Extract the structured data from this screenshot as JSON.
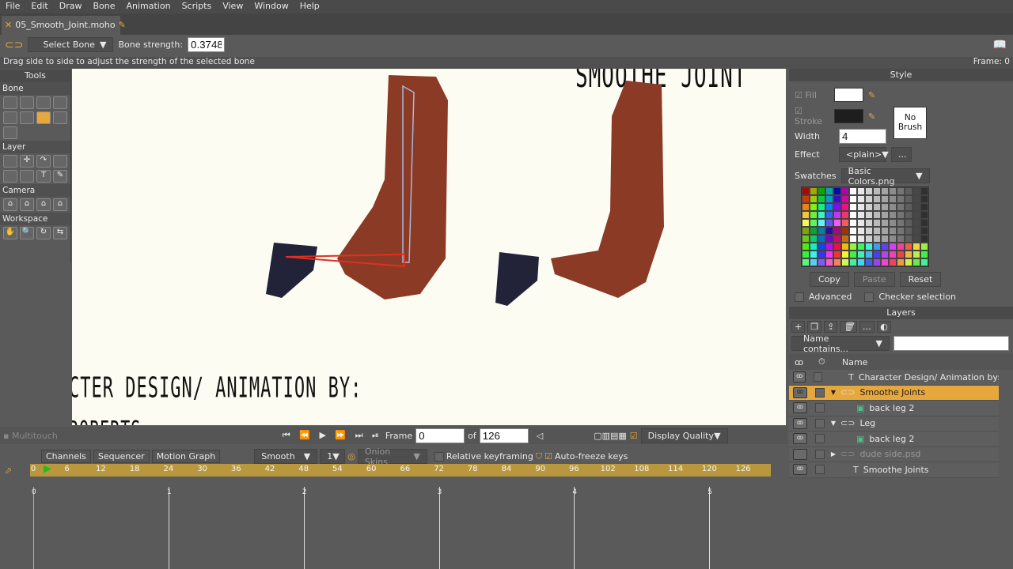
{
  "menu": [
    "File",
    "Edit",
    "Draw",
    "Bone",
    "Animation",
    "Scripts",
    "View",
    "Window",
    "Help"
  ],
  "document_tab": "05_Smooth_Joint.moho",
  "toolbar": {
    "tool": "Select Bone",
    "strength_label": "Bone strength:",
    "strength_value": "0.3748"
  },
  "status": {
    "hint": "Drag side to side to adjust the strength of the selected bone",
    "frame": "Frame: 0"
  },
  "tools": {
    "title": "Tools",
    "sections": [
      "Bone",
      "Layer",
      "Camera",
      "Workspace"
    ]
  },
  "canvas": {
    "title_text": "SMOOTHE JOINT",
    "credit_text": "CTER DESIGN/ ANIMATION BY:",
    "name_text": "ROBERTS"
  },
  "style": {
    "title": "Style",
    "fill": "Fill",
    "stroke": "Stroke",
    "width_label": "Width",
    "width_value": "4",
    "no_brush": "No Brush",
    "effect_label": "Effect",
    "effect_value": "<plain>",
    "effect_more": "...",
    "swatches_label": "Swatches",
    "swatches_value": "Basic Colors.png",
    "copy": "Copy",
    "paste": "Paste",
    "reset": "Reset",
    "advanced": "Advanced",
    "checker": "Checker selection",
    "fill_color": "#ffffff",
    "stroke_color": "#1e1e1e"
  },
  "layers": {
    "title": "Layers",
    "filter": "Name contains...",
    "filter_value": "",
    "col_name": "Name",
    "items": [
      {
        "name": "Character Design/ Animation by: Mil",
        "type": "text",
        "indent": 0
      },
      {
        "name": "Smoothe Joints",
        "type": "bone",
        "indent": 0,
        "selected": true,
        "expanded": true
      },
      {
        "name": "back leg 2",
        "type": "image",
        "indent": 1
      },
      {
        "name": "Leg",
        "type": "bone",
        "indent": 0,
        "expanded": true
      },
      {
        "name": "back leg 2",
        "type": "image",
        "indent": 1
      },
      {
        "name": "dude side.psd",
        "type": "bone",
        "indent": 0,
        "hidden": true,
        "expanded": false
      },
      {
        "name": "Smoothe Joints",
        "type": "text",
        "indent": 0
      }
    ]
  },
  "transport": {
    "multitouch": "Multitouch",
    "frame_label": "Frame",
    "frame": "0",
    "of_label": "of",
    "total": "126",
    "display_quality": "Display Quality"
  },
  "timeline": {
    "tabs": [
      "Channels",
      "Sequencer",
      "Motion Graph"
    ],
    "interp": "Smooth",
    "interval": "1",
    "onion": "Onion Skins",
    "relative": "Relative keyframing",
    "autofreeze": "Auto-freeze keys",
    "ticks": [
      "0",
      "6",
      "12",
      "18",
      "24",
      "30",
      "36",
      "42",
      "48",
      "54",
      "60",
      "66",
      "72",
      "78",
      "84",
      "90",
      "96",
      "102",
      "108",
      "114",
      "120",
      "126"
    ],
    "seconds": [
      "0",
      "1",
      "2",
      "3",
      "4",
      "5"
    ]
  },
  "accent": "#e6a83d"
}
